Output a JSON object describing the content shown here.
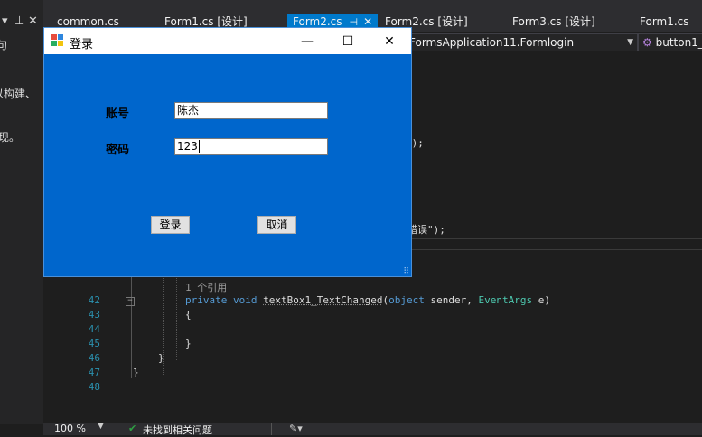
{
  "left_panel": {
    "text_lines": [
      "句",
      "以构建、",
      "现。"
    ]
  },
  "tabs": [
    {
      "label": "common.cs",
      "active": false
    },
    {
      "label": "Form1.cs [设计]",
      "active": false
    },
    {
      "label": "Form2.cs",
      "active": true
    },
    {
      "label": "Form2.cs [设计]",
      "active": false
    },
    {
      "label": "Form3.cs [设计]",
      "active": false
    },
    {
      "label": "Form1.cs",
      "active": false
    }
  ],
  "nav": {
    "class_selector": "FormsApplication11.Formlogin",
    "member_selector": "button1_"
  },
  "background_code": {
    "frag_paren": "();",
    "frag_error": "错误\");"
  },
  "code": {
    "lines": [
      {
        "num": "42",
        "sig_kw": "private void ",
        "sig_name": "textBox1_TextChanged",
        "sig_open": "(",
        "sig_p1": "object",
        "sig_p1n": " sender, ",
        "sig_p2": "EventArgs",
        "sig_rest": " e)"
      },
      {
        "num": "43",
        "text": "{"
      },
      {
        "num": "44",
        "text": ""
      },
      {
        "num": "45",
        "text": "}"
      },
      {
        "num": "46",
        "text": "}"
      },
      {
        "num": "47",
        "text": "}"
      },
      {
        "num": "48",
        "text": ""
      }
    ],
    "reference_hint": "1 个引用"
  },
  "status": {
    "zoom": "100 %",
    "issues": "未找到相关问题"
  },
  "dialog": {
    "title": "登录",
    "account_label": "账号",
    "account_value": "陈杰",
    "password_label": "密码",
    "password_value": "123",
    "login_button": "登录",
    "cancel_button": "取消"
  },
  "colors": {
    "dialog_background": "#0066cc",
    "active_tab": "#007acc",
    "editor_background": "#1e1e1e"
  }
}
